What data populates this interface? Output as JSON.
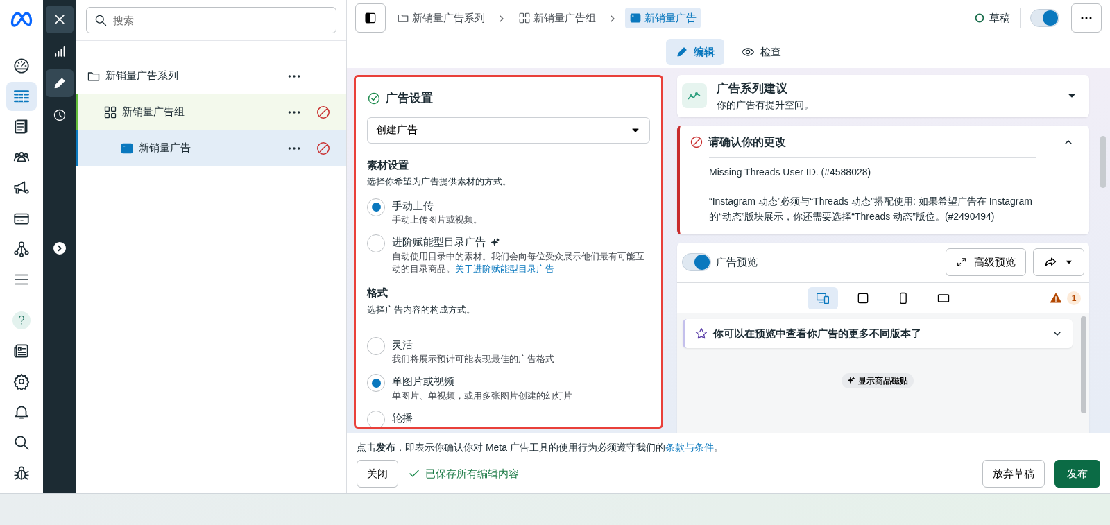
{
  "nav_rail": {
    "top_items": [
      {
        "selected": false
      },
      {
        "selected": true
      },
      {
        "selected": false
      },
      {
        "selected": false
      },
      {
        "selected": false
      },
      {
        "selected": false
      },
      {
        "selected": false
      },
      {
        "selected": false
      }
    ],
    "bottom_items": [
      {
        "selected": false
      },
      {
        "selected": false
      },
      {
        "selected": false
      },
      {
        "selected": false
      },
      {
        "selected": false
      },
      {
        "selected": false
      }
    ]
  },
  "tool_rail": [
    {
      "selected": false
    },
    {
      "selected": true
    },
    {
      "selected": false
    }
  ],
  "search": {
    "placeholder": "搜索"
  },
  "tree": [
    {
      "kind": "campaign",
      "label": "新销量广告系列",
      "selected": false,
      "highlighted": false,
      "error": false,
      "children": [
        {
          "kind": "adset",
          "label": "新销量广告组",
          "selected": false,
          "highlighted": true,
          "error": true,
          "children": [
            {
              "kind": "ad",
              "label": "新销量广告",
              "selected": true,
              "highlighted": false,
              "error": true
            }
          ]
        }
      ]
    }
  ],
  "breadcrumb": [
    {
      "kind": "campaign",
      "label": "新销量广告系列",
      "selected": false
    },
    {
      "kind": "adset",
      "label": "新销量广告组",
      "selected": false
    },
    {
      "kind": "ad",
      "label": "新销量广告",
      "selected": true
    }
  ],
  "status": {
    "label": "草稿"
  },
  "publish_toggle": {
    "on": true
  },
  "view_tabs": [
    {
      "label": "编辑",
      "selected": true
    },
    {
      "label": "检查",
      "selected": false
    }
  ],
  "ad_settings": {
    "title": "广告设置",
    "complete": true,
    "mode_select": {
      "value": "创建广告"
    },
    "sections": [
      {
        "title": "素材设置",
        "subtitle": "选择你希望为广告提供素材的方式。",
        "options": [
          {
            "label": "手动上传",
            "description": "手动上传图片或视频。",
            "selected": true,
            "sparkle": false
          },
          {
            "label": "进阶赋能型目录广告",
            "description": "自动使用目录中的素材。我们会向每位受众展示他们最有可能互动的目录商品。",
            "link": "关于进阶赋能型目录广告",
            "selected": false,
            "sparkle": true
          }
        ]
      },
      {
        "title": "格式",
        "subtitle": "选择广告内容的构成方式。",
        "options": [
          {
            "label": "灵活",
            "description": "我们将展示预计可能表现最佳的广告格式",
            "selected": false,
            "sparkle": false
          },
          {
            "label": "单图片或视频",
            "description": "单图片、单视频，或用多张图片创建的幻灯片",
            "selected": true,
            "sparkle": false
          },
          {
            "label": "轮播",
            "selected": false,
            "sparkle": false
          }
        ]
      }
    ]
  },
  "suggestion": {
    "title": "广告系列建议",
    "subtitle": "你的广告有提升空间。",
    "expanded": false
  },
  "errors": {
    "title": "请确认你的更改",
    "expanded": true,
    "messages": [
      "Missing Threads User ID. (#4588028)",
      "“Instagram 动态”必须与“Threads 动态”搭配使用: 如果希望广告在 Instagram 的“动态”版块展示，你还需要选择“Threads 动态”版位。(#2490494)"
    ]
  },
  "preview": {
    "on": true,
    "label": "广告预览",
    "advanced_button": "高级预览",
    "devices": [
      {
        "selected": true
      },
      {
        "selected": false
      },
      {
        "selected": false
      },
      {
        "selected": false
      }
    ],
    "warning_count": "1",
    "tip": {
      "text": "你可以在预览中查看你广告的更多不同版本了",
      "expanded": false
    },
    "chip": "显示商品磁贴"
  },
  "footer": {
    "notice": "点击**发布**，即表示你确认你对 Meta 广告工具的使用行为必须遵守我们的",
    "notice_link": "条款与条件",
    "notice_end": "。",
    "close_button": "关闭",
    "saved": "已保存所有编辑内容",
    "discard_button": "放弃草稿",
    "publish_button": "发布"
  }
}
